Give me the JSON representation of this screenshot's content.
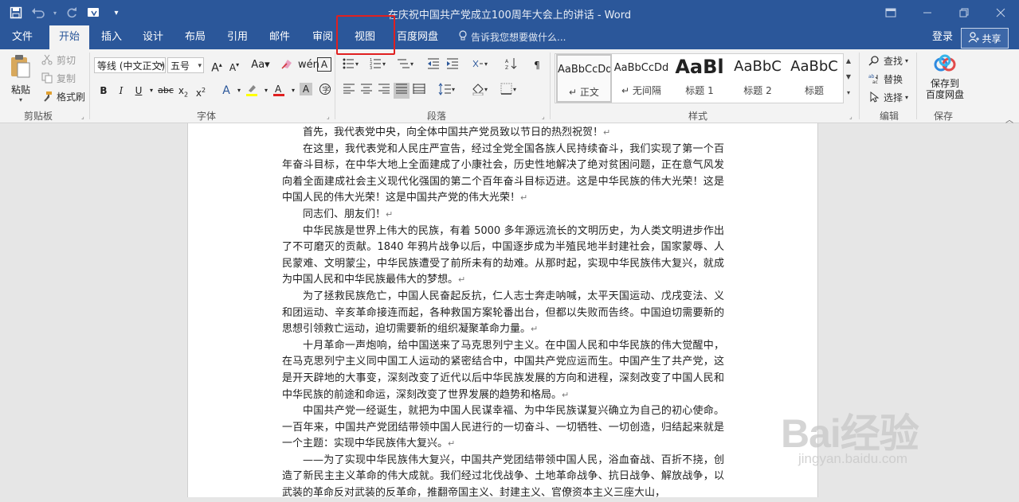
{
  "window": {
    "title": "在庆祝中国共产党成立100周年大会上的讲话 - Word",
    "controls": [
      "restore-ribbon",
      "minimize",
      "maximize",
      "close"
    ]
  },
  "qat": {
    "icons": [
      "save-icon",
      "undo-icon",
      "redo-icon",
      "touch-mode-icon",
      "customize-icon"
    ]
  },
  "menu": {
    "tabs": [
      {
        "label": "文件"
      },
      {
        "label": "开始"
      },
      {
        "label": "插入"
      },
      {
        "label": "设计"
      },
      {
        "label": "布局"
      },
      {
        "label": "引用"
      },
      {
        "label": "邮件"
      },
      {
        "label": "审阅"
      },
      {
        "label": "视图"
      },
      {
        "label": "百度网盘"
      }
    ],
    "active_tab": "开始",
    "tell_me": "告诉我您想要做什么...",
    "login": "登录",
    "share": "共享"
  },
  "ribbon": {
    "clipboard": {
      "paste": "粘贴",
      "cut": "剪切",
      "copy": "复制",
      "format_painter": "格式刷",
      "label": "剪贴板"
    },
    "font": {
      "font_name": "等线 (中文正文)",
      "font_size": "五号",
      "label": "字体"
    },
    "paragraph": {
      "label": "段落"
    },
    "styles": {
      "items": [
        {
          "sample": "AaBbCcDd",
          "name": "正文"
        },
        {
          "sample": "AaBbCcDd",
          "name": "无间隔"
        },
        {
          "sample": "AaBl",
          "name": "标题 1"
        },
        {
          "sample": "AaBbC",
          "name": "标题 2"
        },
        {
          "sample": "AaBbC",
          "name": "标题"
        }
      ],
      "label": "样式"
    },
    "editing": {
      "find": "查找",
      "replace": "替换",
      "select": "选择",
      "label": "编辑"
    },
    "save": {
      "button": "保存到\n百度网盘",
      "label": "保存"
    }
  },
  "document": {
    "paragraphs": [
      "首先，我代表党中央，向全体中国共产党员致以节日的热烈祝贺！",
      "在这里，我代表党和人民庄严宣告，经过全党全国各族人民持续奋斗，我们实现了第一个百年奋斗目标，在中华大地上全面建成了小康社会，历史性地解决了绝对贫困问题，正在意气风发向着全面建成社会主义现代化强国的第二个百年奋斗目标迈进。这是中华民族的伟大光荣！这是中国人民的伟大光荣！这是中国共产党的伟大光荣！",
      "同志们、朋友们！",
      "中华民族是世界上伟大的民族，有着 5000 多年源远流长的文明历史，为人类文明进步作出了不可磨灭的贡献。1840 年鸦片战争以后，中国逐步成为半殖民地半封建社会，国家蒙辱、人民蒙难、文明蒙尘，中华民族遭受了前所未有的劫难。从那时起，实现中华民族伟大复兴，就成为中国人民和中华民族最伟大的梦想。",
      "为了拯救民族危亡，中国人民奋起反抗，仁人志士奔走呐喊，太平天国运动、戊戌变法、义和团运动、辛亥革命接连而起，各种救国方案轮番出台，但都以失败而告终。中国迫切需要新的思想引领救亡运动，迫切需要新的组织凝聚革命力量。",
      "十月革命一声炮响，给中国送来了马克思列宁主义。在中国人民和中华民族的伟大觉醒中，在马克思列宁主义同中国工人运动的紧密结合中，中国共产党应运而生。中国产生了共产党，这是开天辟地的大事变，深刻改变了近代以后中华民族发展的方向和进程，深刻改变了中国人民和中华民族的前途和命运，深刻改变了世界发展的趋势和格局。",
      "中国共产党一经诞生，就把为中国人民谋幸福、为中华民族谋复兴确立为自己的初心使命。一百年来，中国共产党团结带领中国人民进行的一切奋斗、一切牺牲、一切创造，归结起来就是一个主题：实现中华民族伟大复兴。",
      "——为了实现中华民族伟大复兴，中国共产党团结带领中国人民，浴血奋战、百折不挠，创造了新民主主义革命的伟大成就。我们经过北伐战争、土地革命战争、抗日战争、解放战争，以武装的革命反对武装的反革命，推翻帝国主义、封建主义、官僚资本主义三座大山，"
    ],
    "paragraph_mark": "↵"
  },
  "watermark": {
    "logo_text": "Bai经验",
    "url": "jingyan.baidu.com"
  }
}
